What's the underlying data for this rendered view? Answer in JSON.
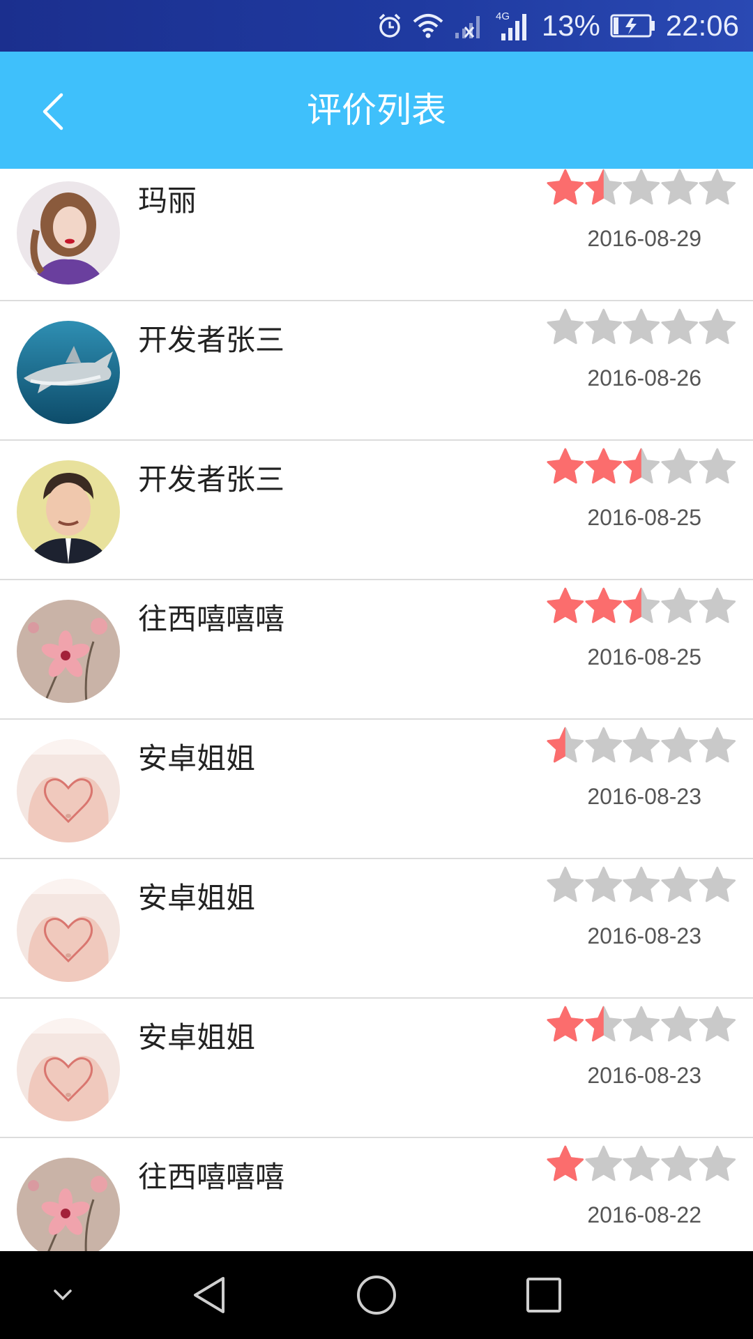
{
  "status_bar": {
    "battery_percent": "13%",
    "time": "22:06",
    "network_label": "4G",
    "icons": [
      "alarm-icon",
      "wifi-icon",
      "signal-x-icon",
      "signal-4g-icon",
      "battery-charging-icon"
    ]
  },
  "header": {
    "title": "评价列表",
    "back_icon": "chevron-left-icon"
  },
  "colors": {
    "app_bar": "#3fc0fb",
    "star_filled": "#fb6d6d",
    "star_empty": "#c9c9c9",
    "divider": "#dcdcdc"
  },
  "reviews": [
    {
      "name": "玛丽",
      "rating": 1.5,
      "date": "2016-08-29",
      "avatar": "woman-portrait-avatar"
    },
    {
      "name": "开发者张三",
      "rating": 0,
      "date": "2016-08-26",
      "avatar": "shark-avatar"
    },
    {
      "name": "开发者张三",
      "rating": 2.5,
      "date": "2016-08-25",
      "avatar": "man-portrait-avatar"
    },
    {
      "name": "往西嘻嘻嘻",
      "rating": 2.5,
      "date": "2016-08-25",
      "avatar": "pink-flower-avatar"
    },
    {
      "name": "安卓姐姐",
      "rating": 0.5,
      "date": "2016-08-23",
      "avatar": "heart-hands-avatar"
    },
    {
      "name": "安卓姐姐",
      "rating": 0,
      "date": "2016-08-23",
      "avatar": "heart-hands-avatar"
    },
    {
      "name": "安卓姐姐",
      "rating": 1.5,
      "date": "2016-08-23",
      "avatar": "heart-hands-avatar"
    },
    {
      "name": "往西嘻嘻嘻",
      "rating": 1,
      "date": "2016-08-22",
      "avatar": "pink-flower-avatar"
    }
  ],
  "nav_bar": {
    "buttons": [
      "chevron-down-icon",
      "back-triangle-icon",
      "home-circle-icon",
      "recents-square-icon"
    ]
  }
}
